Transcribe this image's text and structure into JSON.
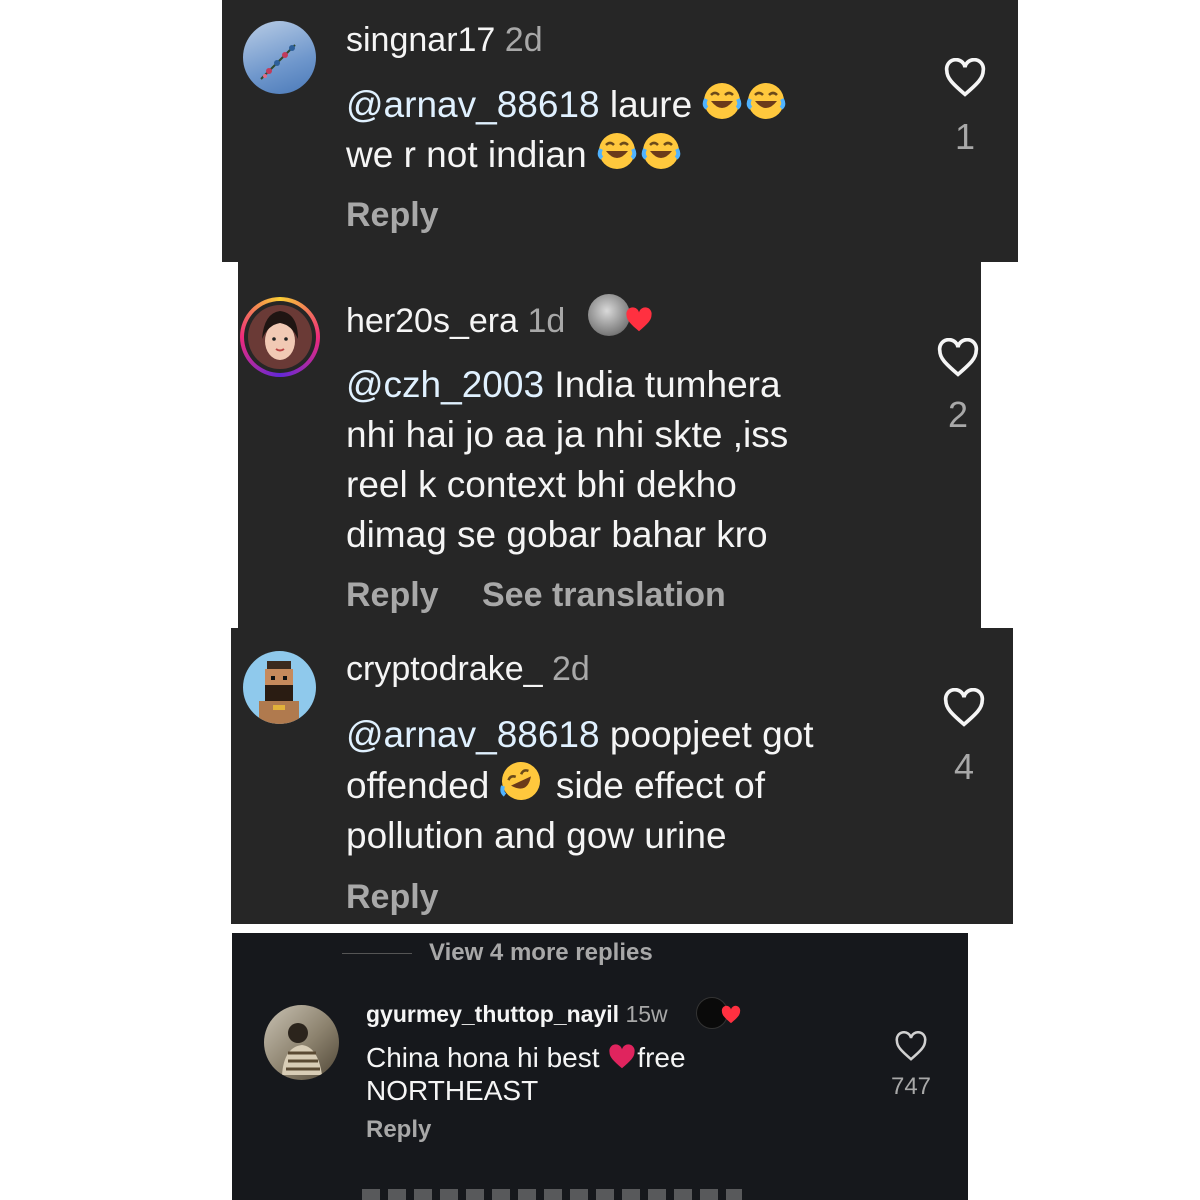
{
  "comments": [
    {
      "username": "singnar17",
      "time": "2d",
      "mention": "@arnav_88618",
      "text_line1": "laure",
      "text_line2": "we r not indian",
      "reply_label": "Reply",
      "likes": "1"
    },
    {
      "username": "her20s_era",
      "time": "1d",
      "mention": "@czh_2003",
      "text_line1": "India tumhera",
      "text_line2": "nhi hai jo aa ja nhi skte ,iss",
      "text_line3": "reel k context bhi dekho",
      "text_line4": "dimag se gobar bahar kro",
      "reply_label": "Reply",
      "translate_label": "See translation",
      "likes": "2"
    },
    {
      "username": "cryptodrake_",
      "time": "2d",
      "mention": "@arnav_88618",
      "text_line1": "poopjeet got",
      "text_line2a": "offended",
      "text_line2b": "side effect of",
      "text_line3": "pollution and gow urine",
      "reply_label": "Reply",
      "likes": "4"
    },
    {
      "username": "gyurmey_thuttop_nayil",
      "time": "15w",
      "text_line1a": "China hona hi best",
      "text_line1b": "free",
      "text_line2": "NORTHEAST",
      "reply_label": "Reply",
      "likes": "747"
    }
  ],
  "view_more_label": "View 4 more replies",
  "colors": {
    "panel": "#262626",
    "panel_bottom": "#16181c",
    "text": "#f5f5f5",
    "muted": "#a8a8a8",
    "mention": "#e0f1ff",
    "heart_red": "#ff3040",
    "emoji_yellow": "#ffc83d"
  }
}
